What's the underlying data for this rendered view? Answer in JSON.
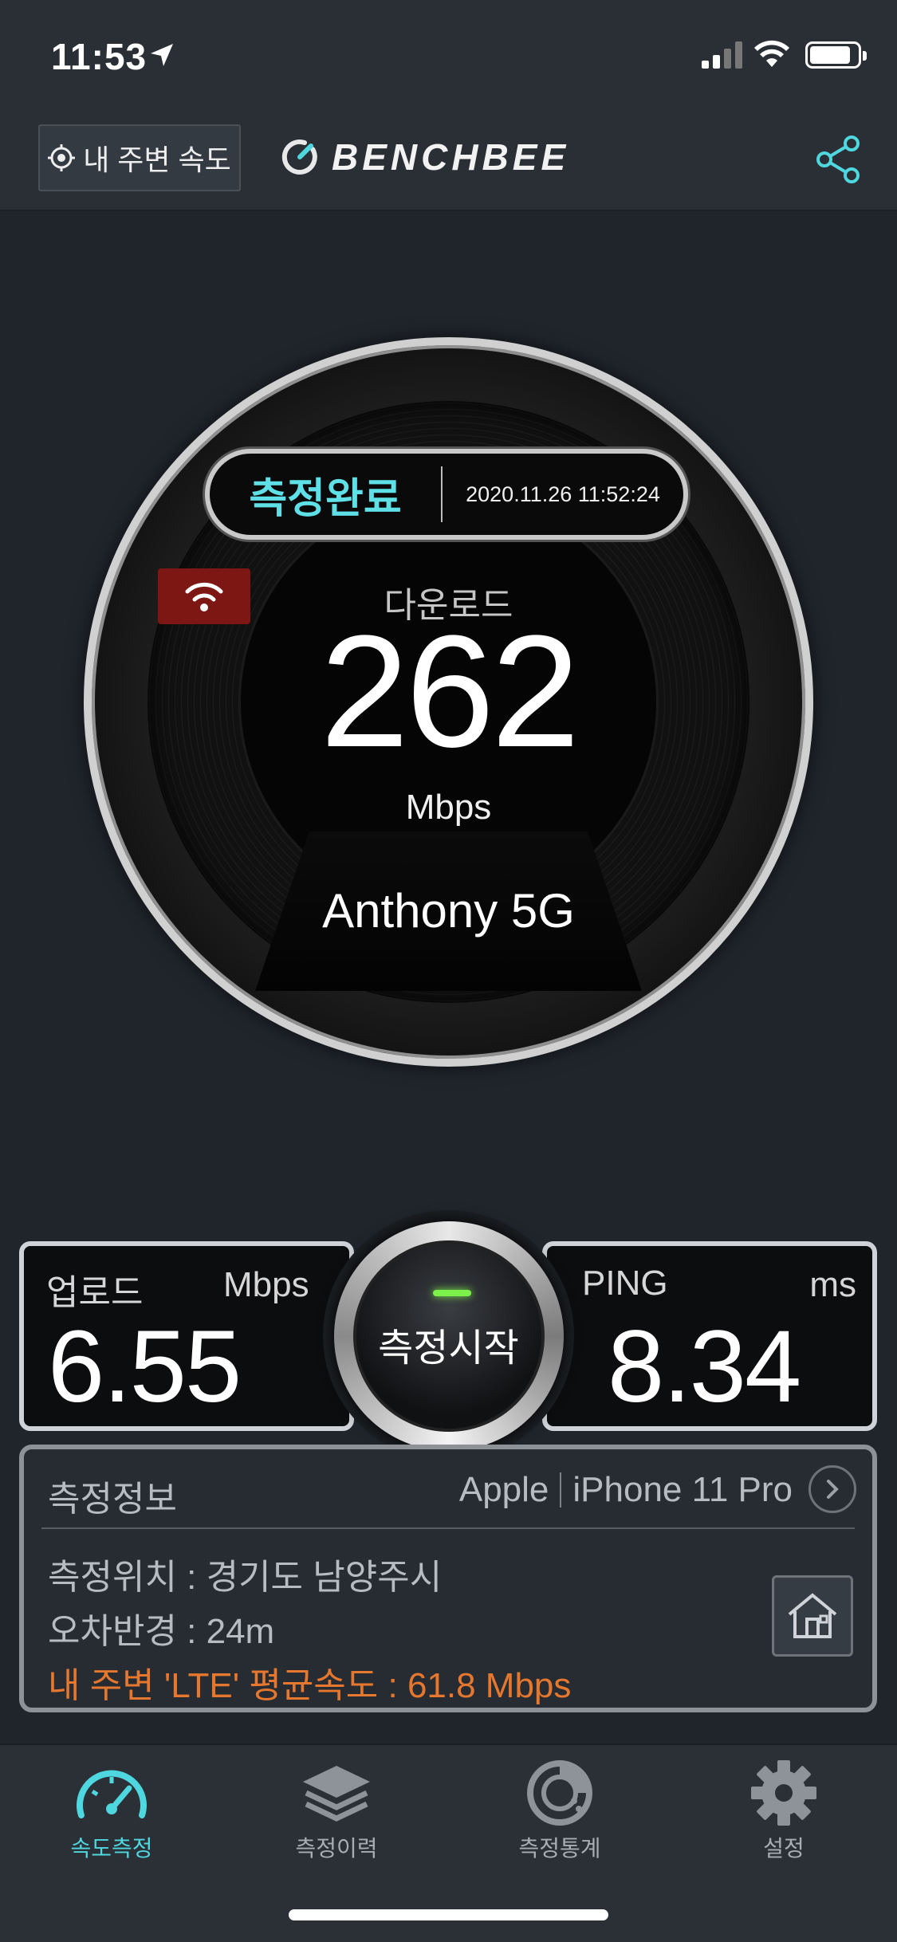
{
  "status_bar": {
    "time": "11:53"
  },
  "header": {
    "nearby_button": "내 주변 속도",
    "logo_text": "BENCHBEE"
  },
  "gauge": {
    "status": "측정완료",
    "date": "2020.11.26 11:52:24",
    "download_label": "다운로드",
    "download_value": "262",
    "download_unit": "Mbps",
    "network_name": "Anthony 5G",
    "wifi_badge_color": "#7d1713"
  },
  "metrics": {
    "upload": {
      "label": "업로드",
      "unit": "Mbps",
      "value": "6.55"
    },
    "ping": {
      "label": "PING",
      "unit": "ms",
      "value": "8.34"
    },
    "start_button": "측정시작"
  },
  "info": {
    "title": "측정정보",
    "brand": "Apple",
    "model": "iPhone 11 Pro",
    "location": "측정위치 : 경기도 남양주시",
    "error_radius": "오차반경 : 24m",
    "nearby_avg": "내 주변 'LTE' 평균속도 : 61.8 Mbps"
  },
  "tabs": [
    {
      "label": "속도측정",
      "icon": "speedometer-icon",
      "active": true
    },
    {
      "label": "측정이력",
      "icon": "layers-icon",
      "active": false
    },
    {
      "label": "측정통계",
      "icon": "stats-icon",
      "active": false
    },
    {
      "label": "설정",
      "icon": "gear-icon",
      "active": false
    }
  ],
  "colors": {
    "accent": "#4fd7df",
    "orange": "#e6772e",
    "background": "#20252c"
  }
}
